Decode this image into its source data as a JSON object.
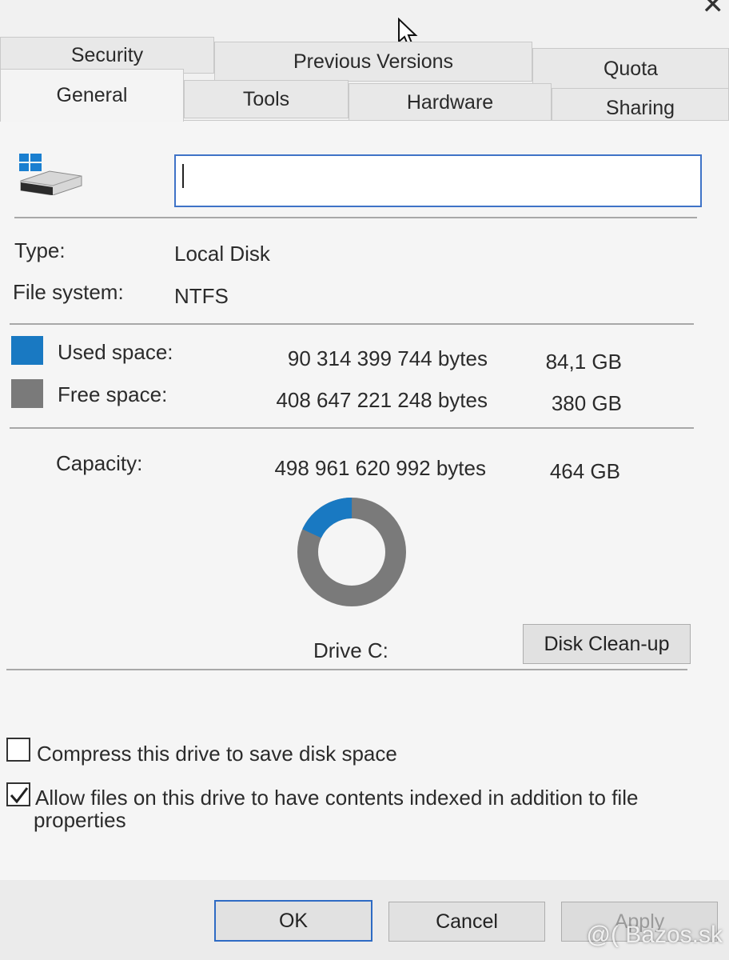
{
  "window": {
    "close_glyph": "✕"
  },
  "tabs": {
    "row1": [
      {
        "label": "Security"
      },
      {
        "label": "Previous Versions"
      },
      {
        "label": "Quota"
      }
    ],
    "row2": [
      {
        "label": "General",
        "active": true
      },
      {
        "label": "Tools"
      },
      {
        "label": "Hardware"
      },
      {
        "label": "Sharing"
      }
    ]
  },
  "general": {
    "drive_name_value": "",
    "drive_icon": "windows-drive-icon",
    "type_label": "Type:",
    "type_value": "Local Disk",
    "fs_label": "File system:",
    "fs_value": "NTFS"
  },
  "space": {
    "used": {
      "label": "Used space:",
      "bytes": "90 314 399 744 bytes",
      "size": "84,1 GB",
      "color": "#1979c2"
    },
    "free": {
      "label": "Free space:",
      "bytes": "408 647 221 248 bytes",
      "size": "380 GB",
      "color": "#7a7a7a"
    },
    "capacity": {
      "label": "Capacity:",
      "bytes": "498 961 620 992 bytes",
      "size": "464 GB"
    },
    "used_fraction": 0.181
  },
  "drive_label": "Drive C:",
  "cleanup_button": "Disk Clean-up",
  "options": {
    "compress": {
      "label": "Compress this drive to save disk space",
      "checked": false
    },
    "index": {
      "label_line1": "Allow files on this drive to have contents indexed in addition to file",
      "label_line2": "properties",
      "checked": true
    }
  },
  "buttons": {
    "ok": "OK",
    "cancel": "Cancel",
    "apply": "Apply"
  },
  "watermark": "@( Bazos.sk"
}
